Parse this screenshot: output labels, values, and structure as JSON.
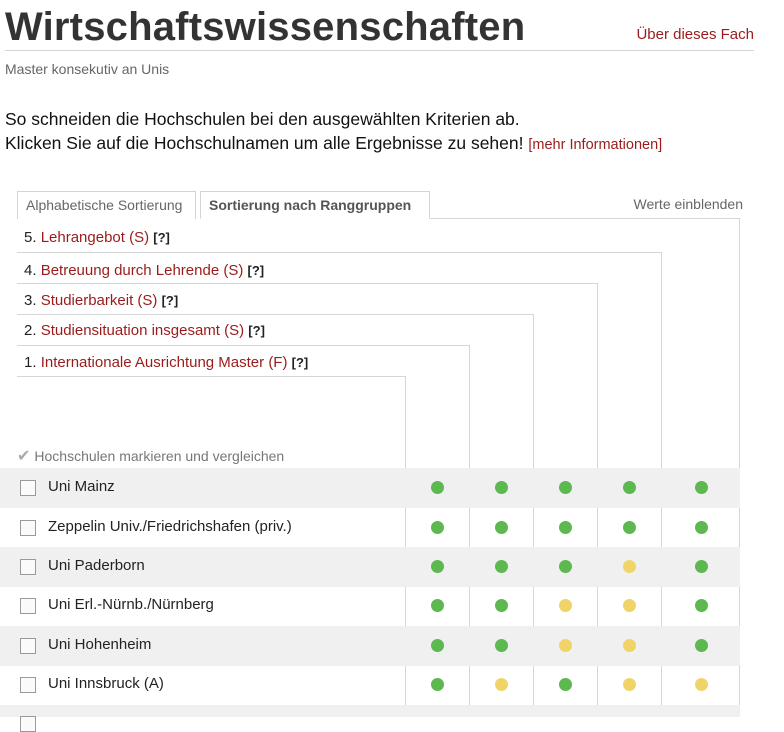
{
  "header": {
    "title": "Wirtschaftswissenschaften",
    "about_link": "Über dieses Fach",
    "subtitle": "Master konsekutiv an Unis"
  },
  "intro": {
    "line1": "So schneiden die Hochschulen bei den ausgewählten Kriterien ab.",
    "line2": "Klicken Sie auf die Hochschulnamen um alle Ergebnisse zu sehen!",
    "more_link": "[mehr Informationen]"
  },
  "tabs": {
    "alphabetical": "Alphabetische Sortierung",
    "rank_groups": "Sortierung nach Ranggruppen",
    "show_values": "Werte einblenden"
  },
  "criteria": [
    {
      "num": "5.",
      "name": "Lehrangebot (S)",
      "help": "[?]"
    },
    {
      "num": "4.",
      "name": "Betreuung durch Lehrende (S)",
      "help": "[?]"
    },
    {
      "num": "3.",
      "name": "Studierbarkeit (S)",
      "help": "[?]"
    },
    {
      "num": "2.",
      "name": "Studiensituation insgesamt (S)",
      "help": "[?]"
    },
    {
      "num": "1.",
      "name": "Internationale Ausrichtung Master (F)",
      "help": "[?]"
    }
  ],
  "compare_label": "Hochschulen markieren und vergleichen",
  "colors": {
    "green": "#5cb84f",
    "yellow": "#f0d46a",
    "accent": "#9b1b1b"
  },
  "universities": [
    {
      "name": "Uni Mainz",
      "ratings": [
        "green",
        "green",
        "green",
        "green",
        "green"
      ]
    },
    {
      "name": "Zeppelin Univ./Friedrichshafen (priv.)",
      "ratings": [
        "green",
        "green",
        "green",
        "green",
        "green"
      ]
    },
    {
      "name": "Uni Paderborn",
      "ratings": [
        "green",
        "green",
        "green",
        "yellow",
        "green"
      ]
    },
    {
      "name": "Uni Erl.-Nürnb./Nürnberg",
      "ratings": [
        "green",
        "green",
        "yellow",
        "yellow",
        "green"
      ]
    },
    {
      "name": "Uni Hohenheim",
      "ratings": [
        "green",
        "green",
        "yellow",
        "yellow",
        "green"
      ]
    },
    {
      "name": "Uni Innsbruck (A)",
      "ratings": [
        "green",
        "yellow",
        "green",
        "yellow",
        "yellow"
      ]
    }
  ]
}
